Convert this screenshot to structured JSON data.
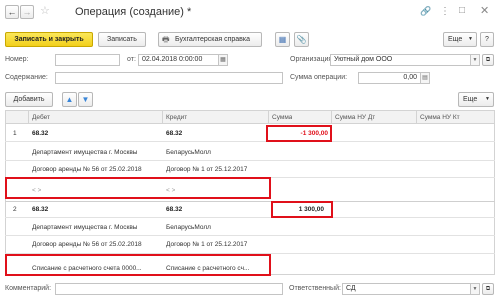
{
  "window": {
    "title": "Операция (создание) *",
    "link_icon": "link-icon",
    "menu_icon": "more-vert-icon",
    "maximize_icon": "maximize-icon",
    "close_icon": "close-icon"
  },
  "toolbar": {
    "save_close_label": "Записать и закрыть",
    "save_label": "Записать",
    "report_label": "Бухгалтерская справка",
    "more_label": "Еще",
    "help_label": "?"
  },
  "form": {
    "number_label": "Номер:",
    "number_value": "",
    "date_label": "от:",
    "date_value": "02.04.2018  0:00:00",
    "org_label": "Организация:",
    "org_value": "Уютный дом ООО",
    "content_label": "Содержание:",
    "content_value": "",
    "sum_label": "Сумма операции:",
    "sum_value": "0,00",
    "comment_label": "Комментарий:",
    "comment_value": "",
    "responsible_label": "Ответственный:",
    "responsible_value": "СД"
  },
  "table_toolbar": {
    "add_label": "Добавить",
    "more_label": "Еще"
  },
  "table": {
    "headers": [
      "Дебет",
      "Кредит",
      "Сумма",
      "Сумма НУ Дт",
      "Сумма НУ Кт"
    ],
    "rows": [
      {
        "n": "1",
        "debit": "68.32",
        "credit": "68.32",
        "sum": "-1 300,00",
        "debit_sub1": "Департамент имущества г. Москвы",
        "credit_sub1": "БеларусьМолл",
        "debit_sub2": "Договор аренды № 56 от 25.02.2018",
        "credit_sub2": "Договор № 1 от 25.12.2017",
        "debit_sub3": "< >",
        "credit_sub3": "< >"
      },
      {
        "n": "2",
        "debit": "68.32",
        "credit": "68.32",
        "sum": "1 300,00",
        "debit_sub1": "Департамент имущества г. Москвы",
        "credit_sub1": "БеларусьМолл",
        "debit_sub2": "Договор аренды № 56 от 25.02.2018",
        "credit_sub2": "Договор № 1 от 25.12.2017",
        "debit_sub3": "Списание с расчетного счета 0000...",
        "credit_sub3": "Списание с расчетного сч..."
      }
    ]
  },
  "colors": {
    "accent_yellow": "#f5d327",
    "highlight_red": "#e0101a",
    "arrow_blue": "#3a86d8"
  }
}
